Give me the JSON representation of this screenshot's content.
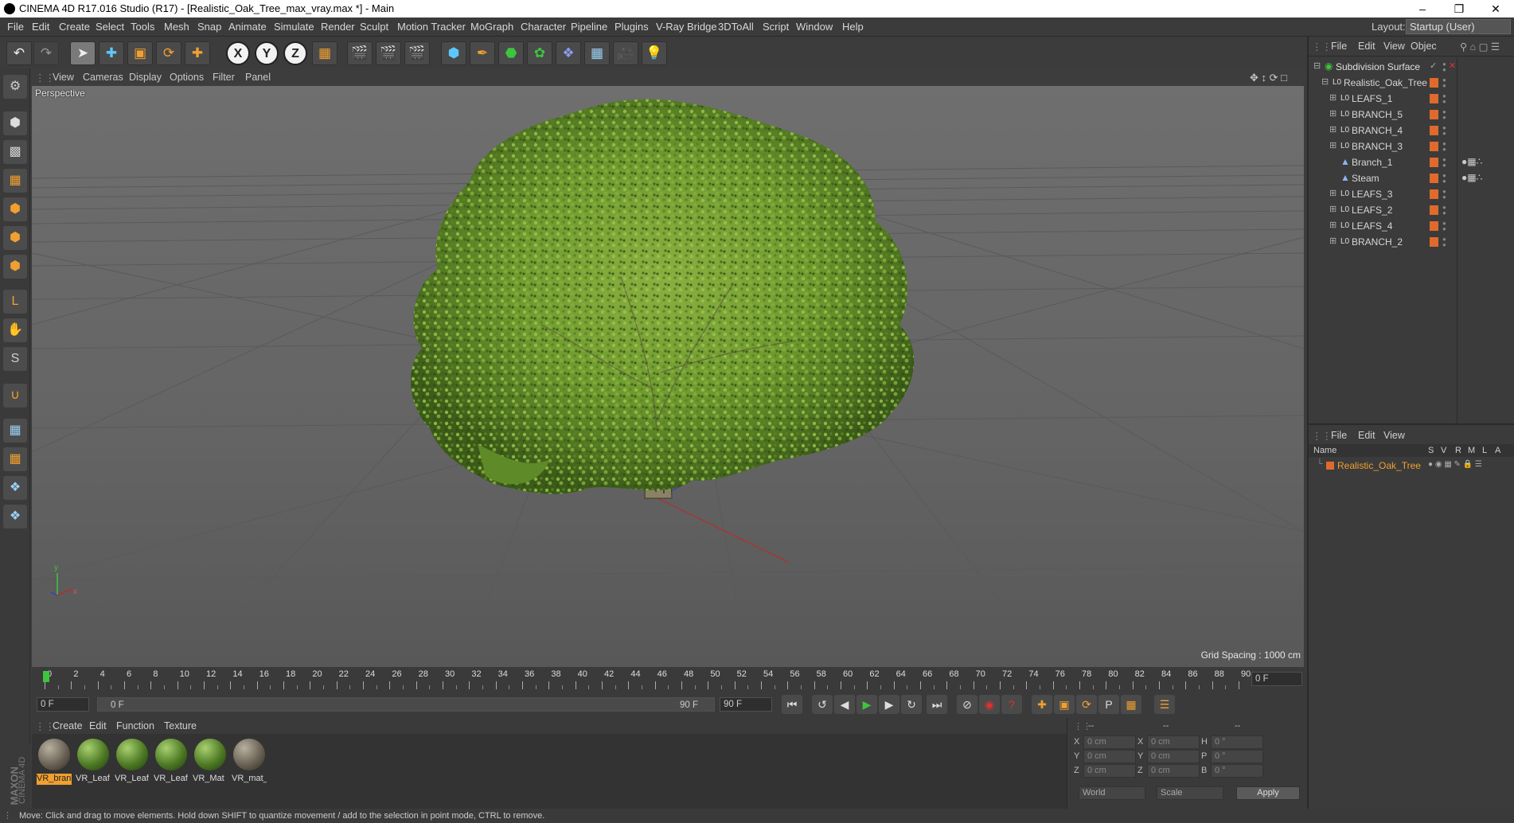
{
  "window": {
    "title": "CINEMA 4D R17.016 Studio (R17) - [Realistic_Oak_Tree_max_vray.max *] - Main"
  },
  "menubar": {
    "items": [
      "File",
      "Edit",
      "Create",
      "Select",
      "Tools",
      "Mesh",
      "Snap",
      "Animate",
      "Simulate",
      "Render",
      "Sculpt",
      "Motion Tracker",
      "MoGraph",
      "Character",
      "Pipeline",
      "Plugins",
      "V-Ray Bridge",
      "3DToAll",
      "Script",
      "Window",
      "Help"
    ],
    "layout_label": "Layout:",
    "layout_value": "Startup (User)"
  },
  "toolbar": {
    "axis_x": "X",
    "axis_y": "Y",
    "axis_z": "Z"
  },
  "viewport": {
    "menu": [
      "View",
      "Cameras",
      "Display",
      "Options",
      "Filter",
      "Panel"
    ],
    "camera_label": "Perspective",
    "grid_spacing": "Grid Spacing : 1000 cm",
    "axis_y": "y",
    "axis_x": "x"
  },
  "timeline": {
    "ticks": [
      "0",
      "2",
      "4",
      "6",
      "8",
      "10",
      "12",
      "14",
      "16",
      "18",
      "20",
      "22",
      "24",
      "26",
      "28",
      "30",
      "32",
      "34",
      "36",
      "38",
      "40",
      "42",
      "44",
      "46",
      "48",
      "50",
      "52",
      "54",
      "56",
      "58",
      "60",
      "62",
      "64",
      "66",
      "68",
      "70",
      "72",
      "74",
      "76",
      "78",
      "80",
      "82",
      "84",
      "86",
      "88",
      "90"
    ],
    "current_frame": "0 F",
    "start_frame": "0 F",
    "range_start": "0 F",
    "range_end": "90 F",
    "end_frame": "90 F",
    "max_frame": "90 F"
  },
  "materials": {
    "menu": [
      "Create",
      "Edit",
      "Function",
      "Texture"
    ],
    "items": [
      {
        "label": "VR_bran",
        "kind": "bark",
        "selected": true
      },
      {
        "label": "VR_Leaf",
        "kind": "leaf",
        "selected": false
      },
      {
        "label": "VR_Leaf",
        "kind": "leaf",
        "selected": false
      },
      {
        "label": "VR_Leaf",
        "kind": "leaf",
        "selected": false
      },
      {
        "label": "VR_Mat",
        "kind": "leaf",
        "selected": false
      },
      {
        "label": "VR_mat_",
        "kind": "bark",
        "selected": false
      }
    ]
  },
  "coordinates": {
    "header": [
      "--",
      "--",
      "--"
    ],
    "rows": [
      {
        "a_label": "X",
        "a_val": "0 cm",
        "b_label": "X",
        "b_val": "0 cm",
        "c_label": "H",
        "c_val": "0 °"
      },
      {
        "a_label": "Y",
        "a_val": "0 cm",
        "b_label": "Y",
        "b_val": "0 cm",
        "c_label": "P",
        "c_val": "0 °"
      },
      {
        "a_label": "Z",
        "a_val": "0 cm",
        "b_label": "Z",
        "b_val": "0 cm",
        "c_label": "B",
        "c_val": "0 °"
      }
    ],
    "space": "World",
    "mode": "Scale",
    "apply": "Apply"
  },
  "object_manager": {
    "menu": [
      "File",
      "Edit",
      "View",
      "Objec"
    ],
    "objects": [
      {
        "name": "Subdivision Surface",
        "level": 0,
        "icon": "subdivision-icon",
        "expand": "-"
      },
      {
        "name": "Realistic_Oak_Tree",
        "level": 1,
        "icon": "null-icon",
        "expand": "-"
      },
      {
        "name": "LEAFS_1",
        "level": 2,
        "icon": "null-icon",
        "expand": "+"
      },
      {
        "name": "BRANCH_5",
        "level": 2,
        "icon": "null-icon",
        "expand": "+"
      },
      {
        "name": "BRANCH_4",
        "level": 2,
        "icon": "null-icon",
        "expand": "+"
      },
      {
        "name": "BRANCH_3",
        "level": 2,
        "icon": "null-icon",
        "expand": "+"
      },
      {
        "name": "Branch_1",
        "level": 2,
        "icon": "polygon-icon",
        "expand": ""
      },
      {
        "name": "Steam",
        "level": 2,
        "icon": "polygon-icon",
        "expand": ""
      },
      {
        "name": "LEAFS_3",
        "level": 2,
        "icon": "null-icon",
        "expand": "+"
      },
      {
        "name": "LEAFS_2",
        "level": 2,
        "icon": "null-icon",
        "expand": "+"
      },
      {
        "name": "LEAFS_4",
        "level": 2,
        "icon": "null-icon",
        "expand": "+"
      },
      {
        "name": "BRANCH_2",
        "level": 2,
        "icon": "null-icon",
        "expand": "+"
      }
    ]
  },
  "layer_manager": {
    "menu": [
      "File",
      "Edit",
      "View"
    ],
    "columns": [
      "Name",
      "S",
      "V",
      "R",
      "M",
      "L",
      "A"
    ],
    "layers": [
      {
        "name": "Realistic_Oak_Tree"
      }
    ]
  },
  "status": {
    "text": "Move: Click and drag to move elements. Hold down SHIFT to quantize movement / add to the selection in point mode, CTRL to remove."
  },
  "maxon": {
    "brand": "MAXON",
    "product": "CINEMA 4D"
  },
  "colors": {
    "accent": "#e06a2c",
    "selection": "#f0a030",
    "play": "#3ec43e"
  }
}
